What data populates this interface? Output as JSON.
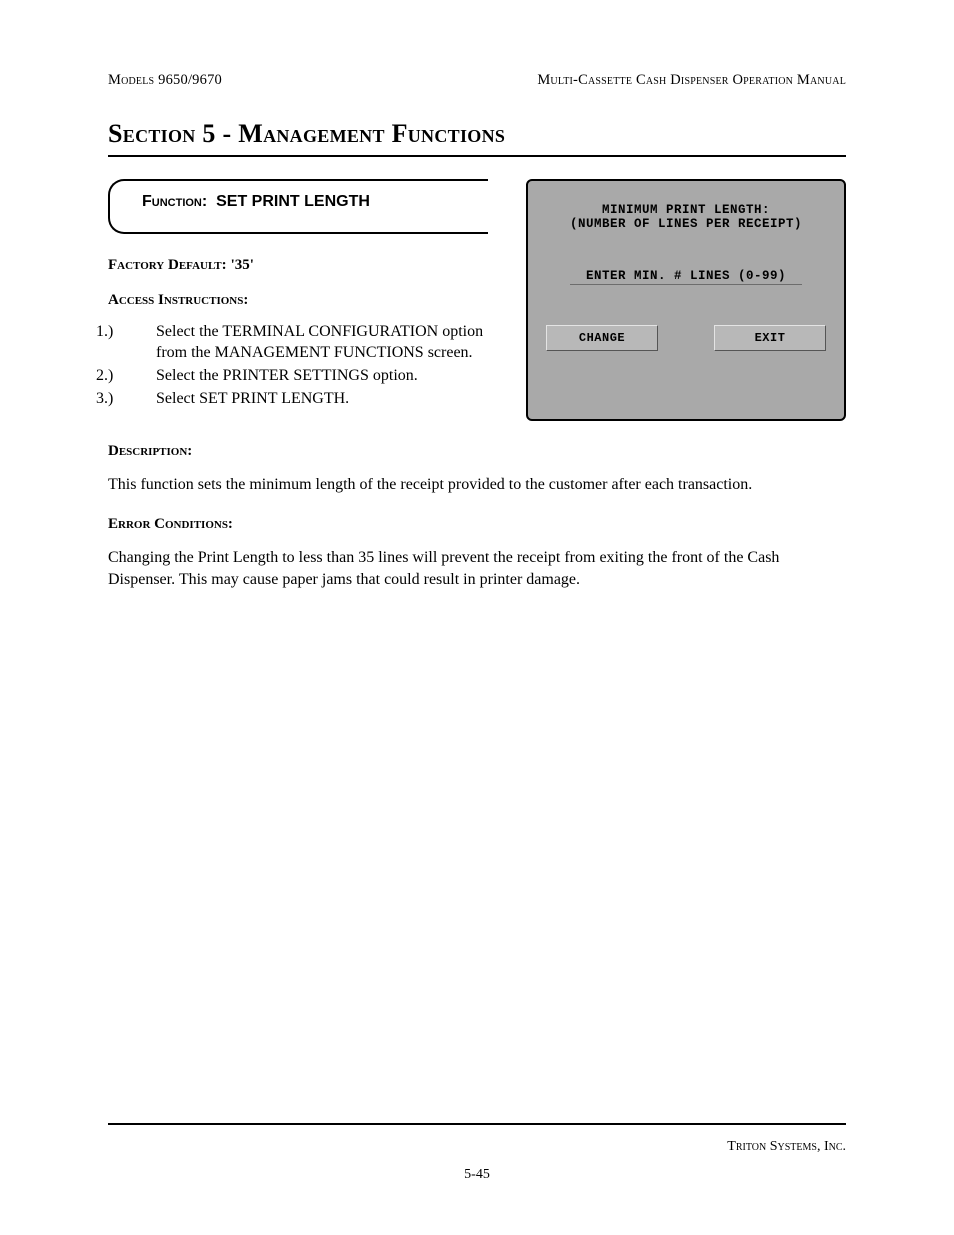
{
  "header": {
    "left": "Models 9650/9670",
    "right": "Multi-Cassette Cash Dispenser Operation Manual"
  },
  "section_title": "Section 5 - Management Functions",
  "function_box": {
    "label": "Function:",
    "name": "SET PRINT LENGTH"
  },
  "factory_default": {
    "label": "Factory Default:",
    "value": "'35'"
  },
  "access": {
    "label": "Access Instructions:",
    "steps": [
      "Select the TERMINAL CONFIGURATION option from the MANAGEMENT FUNCTIONS screen.",
      "Select the  PRINTER SETTINGS option.",
      "Select SET PRINT LENGTH."
    ]
  },
  "description": {
    "label": "Description:",
    "text": "This function sets the minimum length of the receipt provided to the customer after each transaction."
  },
  "error": {
    "label": "Error Conditions:",
    "text": "Changing the Print Length to less than 35 lines will prevent the receipt from exiting the front of the Cash Dispenser.  This may cause paper jams that could result in printer damage."
  },
  "terminal": {
    "line1": "MINIMUM PRINT LENGTH:",
    "line2": "(NUMBER OF LINES PER RECEIPT)",
    "input_label": "ENTER MIN. # LINES (0-99)",
    "buttons": {
      "change": "CHANGE",
      "exit": "EXIT"
    }
  },
  "footer": {
    "company": "Triton Systems, Inc.",
    "page": "5-45"
  }
}
